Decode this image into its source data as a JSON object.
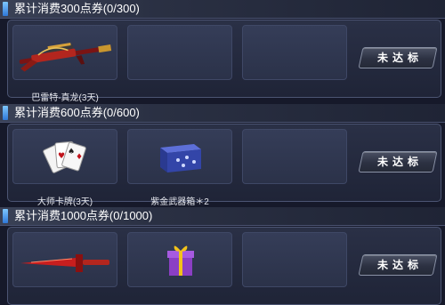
{
  "sections": [
    {
      "title": "累计消费300点券(0/300)",
      "status": "未达标",
      "rewards": [
        {
          "label": "巴雷特-真龙(3天)",
          "icon": "sniper-rifle-icon"
        },
        {
          "label": "",
          "icon": ""
        },
        {
          "label": "",
          "icon": ""
        }
      ]
    },
    {
      "title": "累计消费600点券(0/600)",
      "status": "未达标",
      "rewards": [
        {
          "label": "大师卡牌(3天)",
          "icon": "playing-cards-icon"
        },
        {
          "label": "紫金武器箱＊2",
          "icon": "weapon-case-icon"
        },
        {
          "label": "",
          "icon": ""
        }
      ]
    },
    {
      "title": "累计消费1000点券(0/1000)",
      "status": "未达标",
      "rewards": [
        {
          "label": "",
          "icon": "red-blade-icon"
        },
        {
          "label": "",
          "icon": "gift-box-icon"
        },
        {
          "label": "",
          "icon": ""
        }
      ]
    }
  ]
}
